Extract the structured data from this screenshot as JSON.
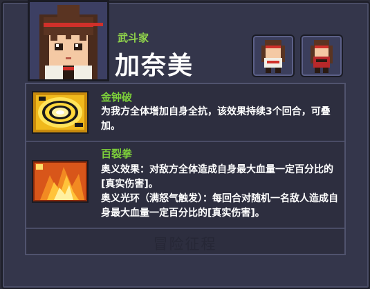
{
  "character": {
    "class_label": "武斗家",
    "name": "加奈美"
  },
  "skins": [
    {
      "icon": "character-skin-1-icon"
    },
    {
      "icon": "character-skin-2-icon"
    }
  ],
  "skills": [
    {
      "name": "金钟破",
      "description": "为我方全体增加自身全抗，该效果持续3个回合，可叠加。",
      "icon": "golden-swirl-icon"
    },
    {
      "name": "百裂拳",
      "description_line1": "奥义效果：对敌方全体造成自身最大血量一定百分比的[真实伤害]。",
      "description_line2": "奥义光环（满怒气触发）：每回合对随机一名敌人造成自身最大血量一定百分比的[真实伤害]。",
      "icon": "flame-burst-icon"
    }
  ],
  "watermark": "冒险征程",
  "colors": {
    "skill_name": "#7ccf3a",
    "class_label": "#8fd34b",
    "panel_bg": "#2d2e3f"
  }
}
